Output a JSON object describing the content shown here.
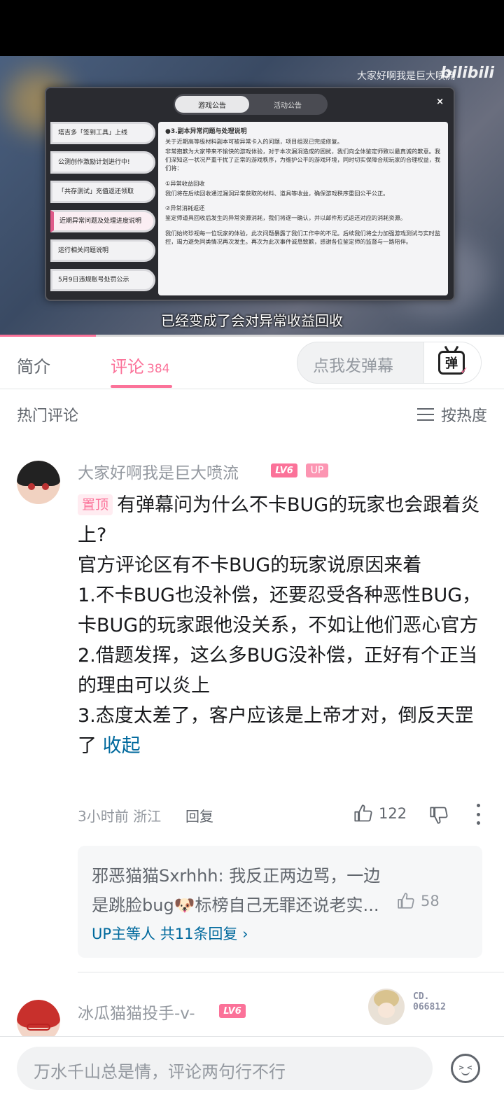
{
  "video": {
    "uploader_watermark": "大家好啊我是巨大喷流",
    "brand_logo": "bilibili",
    "subtitle": "已经变成了会对异常收益回收",
    "progress_fraction": 0.19,
    "game_panel": {
      "tab_active": "游戏公告",
      "tab_inactive": "活动公告",
      "close": "×",
      "items": [
        "塔吉多「签到工具」上线",
        "公测创作激励计划进行中!",
        "「共存测试」充值返还领取",
        "近期异常问题及处理进度说明",
        "运行相关问题说明",
        "5月9日违规账号处罚公示"
      ],
      "body": [
        "●3.副本异常问题与处理说明",
        "关于近期高等级材料副本可被异常卡入的问题，项目组现已完成修复。",
        "非常抱歉为大家带来不愉快的游戏体验，对于本次漏洞造成的困扰，我们向全体鉴定师致以最真诚的歉意。我们深知这一状况严重干扰了正常的游戏秩序，为维护公平的游戏环境，同时切实保障合规玩家的合理权益，我们将：",
        "",
        "①异常收益回收",
        "我们将在后续回收通过漏洞异常获取的材料、道具等收益，确保游戏秩序重回公平公正。",
        "",
        "②异常消耗返还",
        "鉴定师道具回收后发生的异常资源消耗，我们将逐一确认，并以邮件形式返还对应的消耗资源。",
        "",
        "我们始终珍视每一位玩家的体验，此次问题暴露了我们工作中的不足。后续我们将全力加强游戏测试与实时监控，竭力避免同类情况再次发生。再次为此次事件诚恳致歉，感谢各位鉴定师的监督与一路陪伴。"
      ]
    }
  },
  "tabs": {
    "intro": "简介",
    "comments": "评论",
    "comments_count": "384",
    "danmaku_placeholder": "点我发弹幕",
    "danmaku_icon": "弹"
  },
  "sort": {
    "hot_label": "热门评论",
    "sort_label": "按热度"
  },
  "comment1": {
    "username": "大家好啊我是巨大喷流",
    "level": "LV6",
    "up_badge": "UP",
    "pin_tag": "置顶",
    "text": "有弹幕问为什么不卡BUG的玩家也会跟着炎上?\n官方评论区有不卡BUG的玩家说原因来着\n1.不卡BUG也没补偿，还要忍受各种恶性BUG，卡BUG的玩家跟他没关系，不如让他们恶心官方\n2.借题发挥，这么多BUG没补偿，正好有个正当的理由可以炎上\n3.态度太差了，客户应该是上帝才对，倒反天罡了",
    "collapse": "收起",
    "time_location": "3小时前 浙江",
    "reply_label": "回复",
    "likes": "122",
    "reply_preview": {
      "text": "邪恶猫猫Sxrhhh: 我反正两边骂，一边是跳脸bug🐶标榜自己无罪还说老实...",
      "likes": "58",
      "more": "UP主等人 共11条回复"
    }
  },
  "comment2": {
    "username": "冰瓜猫猫投手-v-",
    "level": "LV6",
    "decoration_number": "CD.\n066812"
  },
  "bottom_bar": {
    "placeholder": "万水千山总是情，评论两句行不行"
  },
  "colors": {
    "accent_pink": "#fb7299",
    "link_blue": "#00699d",
    "text_gray": "#9499a0"
  }
}
